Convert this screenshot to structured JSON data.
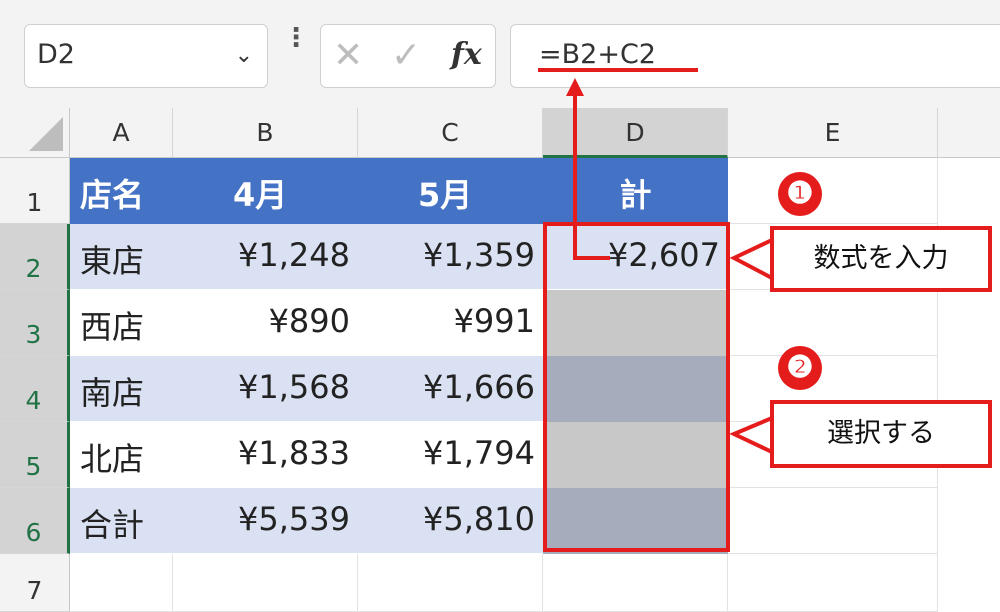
{
  "formula_bar": {
    "name_box": "D2",
    "name_box_dropdown": "⌄",
    "more_icon": "⋮",
    "cancel_icon": "✕",
    "enter_icon": "✓",
    "fx_label": "fx",
    "formula": "=B2+C2"
  },
  "columns": [
    "A",
    "B",
    "C",
    "D",
    "E"
  ],
  "rows": [
    "1",
    "2",
    "3",
    "4",
    "5",
    "6",
    "7"
  ],
  "table": {
    "headers": [
      "店名",
      "4月",
      "5月",
      "計"
    ],
    "rows": [
      {
        "name": "東店",
        "apr": "¥1,248",
        "may": "¥1,359",
        "total": "¥2,607"
      },
      {
        "name": "西店",
        "apr": "¥890",
        "may": "¥991",
        "total": ""
      },
      {
        "name": "南店",
        "apr": "¥1,568",
        "may": "¥1,666",
        "total": ""
      },
      {
        "name": "北店",
        "apr": "¥1,833",
        "may": "¥1,794",
        "total": ""
      },
      {
        "name": "合計",
        "apr": "¥5,539",
        "may": "¥5,810",
        "total": ""
      }
    ]
  },
  "annotations": {
    "step1_badge": "❶",
    "step1_text": "数式を入力",
    "step2_badge": "❷",
    "step2_text": "選択する"
  },
  "colors": {
    "header_fill": "#4472c4",
    "band_fill": "#d9e1f2",
    "annotation_red": "#e51c1c",
    "selection_green": "#217346"
  }
}
